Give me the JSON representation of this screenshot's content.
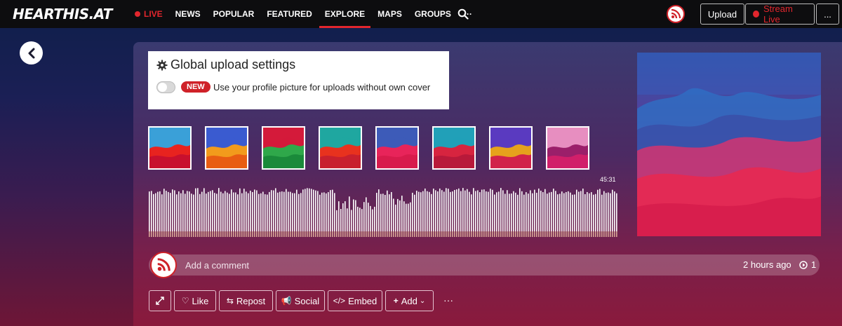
{
  "brand": {
    "logo_text": "HEARTHIS.AT",
    "accent": "#cf2128"
  },
  "nav": {
    "live_label": "LIVE",
    "items": [
      "NEWS",
      "POPULAR",
      "FEATURED",
      "EXPLORE",
      "MAPS",
      "GROUPS",
      "···"
    ],
    "active": "EXPLORE"
  },
  "header_actions": {
    "upload_label": "Upload",
    "stream_live_label": "Stream Live",
    "more_label": "..."
  },
  "settings": {
    "title": "Global upload settings",
    "new_badge": "NEW",
    "toggle_label": "Use your profile picture for uploads without own cover",
    "toggle_on": false
  },
  "thumbnails": [
    {
      "name": "cover-option-1",
      "colors": [
        "#3aa0d8",
        "#e8231f",
        "#c8102e"
      ]
    },
    {
      "name": "cover-option-2",
      "colors": [
        "#3a5bd0",
        "#f29b1c",
        "#e85d12"
      ]
    },
    {
      "name": "cover-option-3",
      "colors": [
        "#d41a3a",
        "#2fa84a",
        "#1a8a3a"
      ]
    },
    {
      "name": "cover-option-4",
      "colors": [
        "#1fa7a0",
        "#e8321e",
        "#c8202e"
      ]
    },
    {
      "name": "cover-option-5",
      "colors": [
        "#3d5bb8",
        "#e8245a",
        "#d81b4c"
      ]
    },
    {
      "name": "cover-option-6",
      "colors": [
        "#21a0b8",
        "#d7243f",
        "#b8193a"
      ]
    },
    {
      "name": "cover-option-7",
      "colors": [
        "#5a3ac0",
        "#e6a21c",
        "#d1234a"
      ]
    },
    {
      "name": "cover-option-8",
      "colors": [
        "#e78ec0",
        "#9b1f6a",
        "#d11f6a"
      ]
    }
  ],
  "player": {
    "duration": "45:31"
  },
  "comment": {
    "placeholder": "Add a comment",
    "time_ago": "2 hours ago",
    "play_count": "1"
  },
  "actions": {
    "expand_icon": "expand-icon",
    "like_label": "Like",
    "repost_label": "Repost",
    "social_label": "Social",
    "embed_label": "Embed",
    "add_label": "Add",
    "more_label": "···"
  }
}
